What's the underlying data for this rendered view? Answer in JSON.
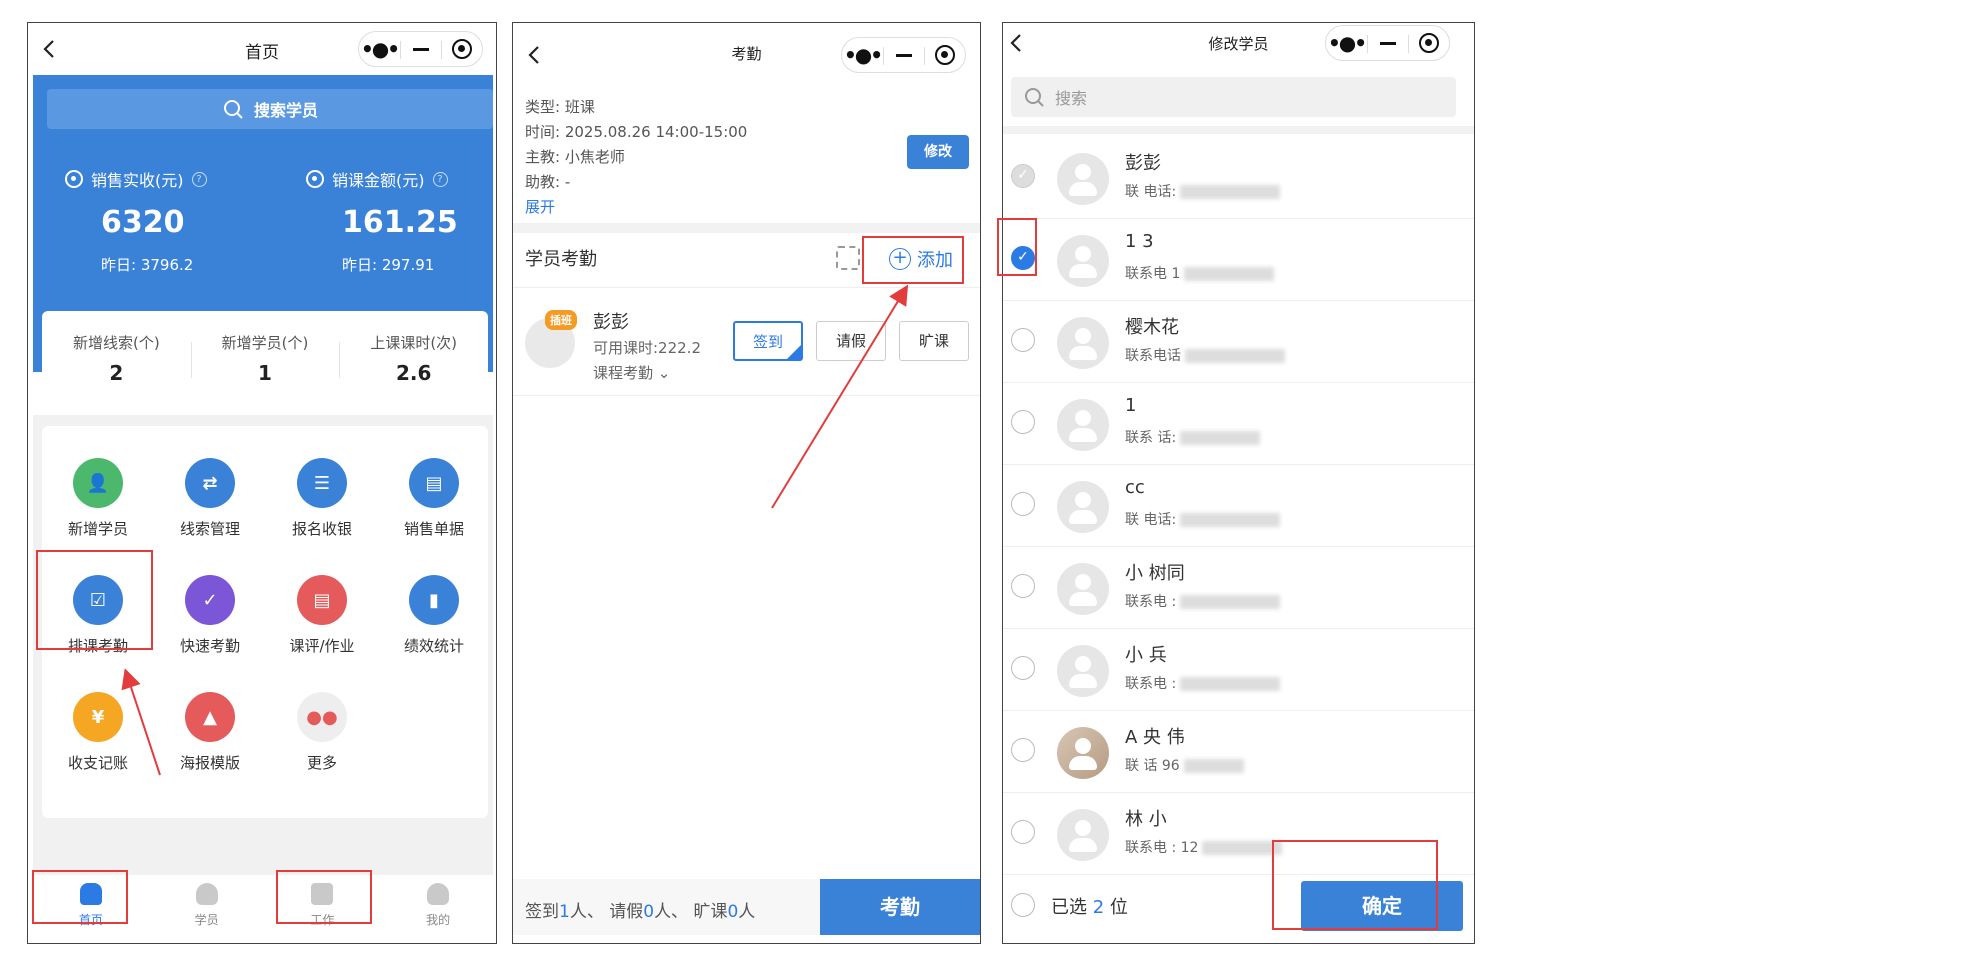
{
  "panel1": {
    "title": "首页",
    "search_label": "搜索学员",
    "stat1": {
      "label": "销售实收(元)",
      "value": "6320",
      "yesterday": "昨日: 3796.2"
    },
    "stat2": {
      "label": "销课金额(元)",
      "value": "161.25",
      "yesterday": "昨日: 297.91"
    },
    "counts": [
      {
        "label": "新增线索(个)",
        "value": "2"
      },
      {
        "label": "新增学员(个)",
        "value": "1"
      },
      {
        "label": "上课课时(次)",
        "value": "2.6"
      }
    ],
    "grid": [
      {
        "label": "新增学员",
        "icon": "add-student-icon",
        "color": "#4cb86e"
      },
      {
        "label": "线索管理",
        "icon": "route-icon",
        "color": "#3a82d8"
      },
      {
        "label": "报名收银",
        "icon": "list-icon",
        "color": "#3a82d8"
      },
      {
        "label": "销售单据",
        "icon": "document-icon",
        "color": "#3a82d8"
      },
      {
        "label": "排课考勤",
        "icon": "schedule-check-icon",
        "color": "#3a82d8"
      },
      {
        "label": "快速考勤",
        "icon": "quick-check-icon",
        "color": "#7b56d6"
      },
      {
        "label": "课评/作业",
        "icon": "homework-icon",
        "color": "#e55b5b"
      },
      {
        "label": "绩效统计",
        "icon": "bar-chart-icon",
        "color": "#3a82d8"
      },
      {
        "label": "收支记账",
        "icon": "yuan-icon",
        "color": "#f5a623"
      },
      {
        "label": "海报模版",
        "icon": "image-icon",
        "color": "#e55b5b"
      },
      {
        "label": "更多",
        "icon": "more-apps-icon",
        "color": "#eeeeee"
      }
    ],
    "tabs": [
      "首页",
      "学员",
      "工作",
      "我的"
    ]
  },
  "panel2": {
    "title": "考勤",
    "info": [
      "类型: 班课",
      "时间: 2025.08.26 14:00-15:00",
      "主教: 小焦老师",
      "助教: -"
    ],
    "expand": "展开",
    "modify": "修改",
    "section_title": "学员考勤",
    "add_label": "添加",
    "student": {
      "badge": "插班",
      "name": "彭彭",
      "hours": "可用课时:222.2",
      "type": "课程考勤"
    },
    "buttons": [
      "签到",
      "请假",
      "旷课"
    ],
    "summary": {
      "a": "签到",
      "an": "1",
      "b": "人、 请假",
      "bn": "0",
      "c": "人、 旷课",
      "cn": "0",
      "d": "人"
    },
    "submit": "考勤"
  },
  "panel3": {
    "title": "修改学员",
    "search_placeholder": "搜索",
    "rows": [
      {
        "name": "彭彭",
        "phone": "联     电话:"
      },
      {
        "name": "1      3",
        "phone": "联系电     1"
      },
      {
        "name": "樱木花   ",
        "phone": "联系电话"
      },
      {
        "name": "1",
        "phone": "联系    话:"
      },
      {
        "name": "cc",
        "phone": "联    电话:"
      },
      {
        "name": "小   树同",
        "phone": "联系电    :"
      },
      {
        "name": "小   兵",
        "phone": "联系电    :"
      },
      {
        "name": "A         央     伟",
        "phone": "联         话     96"
      },
      {
        "name": "林  小",
        "phone": "联系电    : 12"
      }
    ],
    "selected": {
      "a": "已选",
      "n": "2",
      "b": "位"
    },
    "confirm": "确定"
  }
}
